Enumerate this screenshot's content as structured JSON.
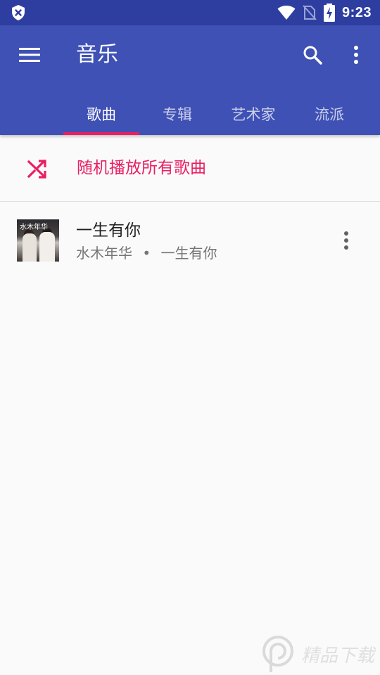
{
  "status_bar": {
    "time": "9:23",
    "icons": [
      "shield-icon",
      "wifi-icon",
      "no-sim-icon",
      "battery-charging-icon"
    ]
  },
  "app_bar": {
    "title": "音乐",
    "icons": [
      "menu-icon",
      "search-icon",
      "more-vert-icon"
    ],
    "background_color": "#3f51b5",
    "status_bar_color": "#2e3ea0"
  },
  "tabs": [
    {
      "label": "歌曲",
      "active": true
    },
    {
      "label": "专辑",
      "active": false
    },
    {
      "label": "艺术家",
      "active": false
    },
    {
      "label": "流派",
      "active": false
    }
  ],
  "accent_color": "#e91e63",
  "shuffle": {
    "label": "随机播放所有歌曲",
    "icon": "shuffle-icon"
  },
  "songs": [
    {
      "title": "一生有你",
      "artist": "水木年华",
      "separator": "•",
      "album": "一生有你",
      "cover_text": "水木年华"
    }
  ],
  "watermark": {
    "text": "精品下载"
  }
}
